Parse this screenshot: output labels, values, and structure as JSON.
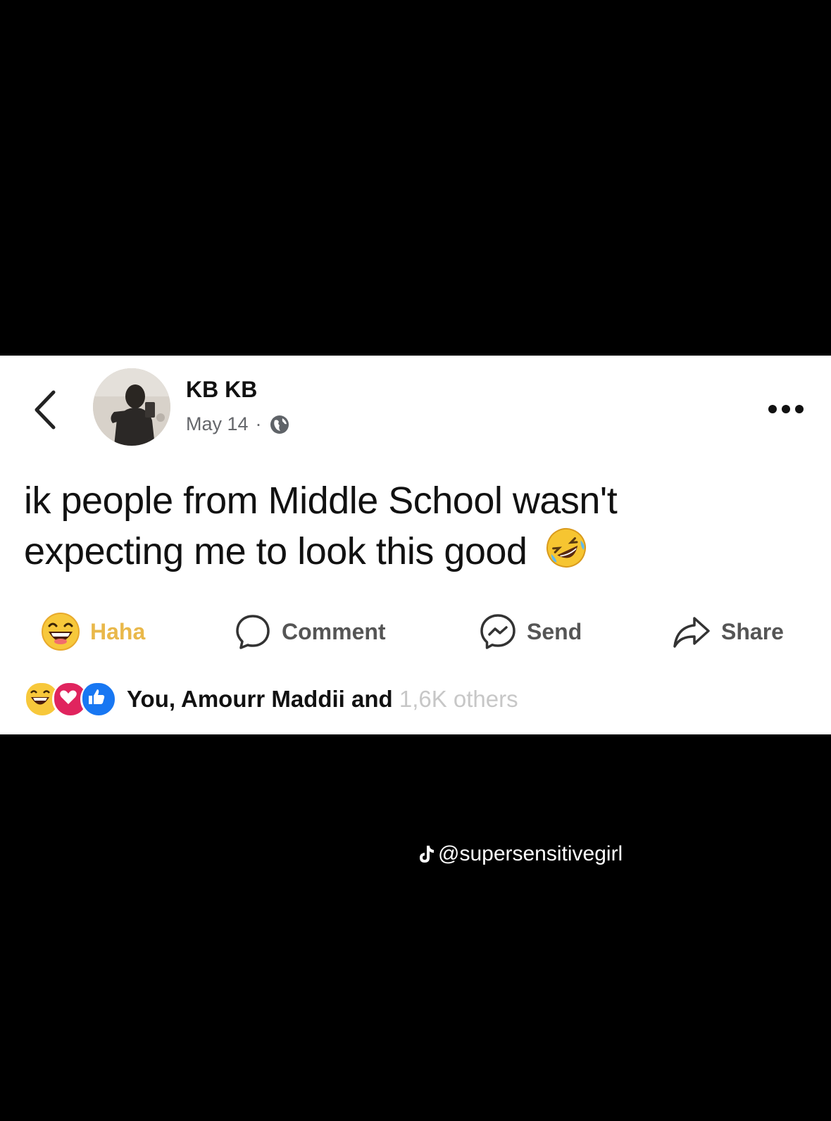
{
  "post": {
    "author": "KB KB",
    "date": "May 14",
    "separator": "·",
    "privacy_icon": "globe-icon",
    "text_line1": "ik people from Middle School wasn't",
    "text_line2": "expecting me to look this good",
    "text_emoji": "rolling-on-floor-laughing-emoji"
  },
  "actions": {
    "haha_label": "Haha",
    "comment_label": "Comment",
    "send_label": "Send",
    "share_label": "Share"
  },
  "reactions": {
    "summary_main": "You, Amourr Maddii and ",
    "summary_faded": "1,6K others",
    "icons": [
      "haha-icon",
      "love-icon",
      "like-icon"
    ]
  },
  "watermark": {
    "handle": "@supersensitivegirl",
    "platform_icon": "tiktok-icon"
  },
  "colors": {
    "background": "#000000",
    "card": "#ffffff",
    "haha": "#e9b84a",
    "like": "#1877f2",
    "love": "#e0245e"
  }
}
